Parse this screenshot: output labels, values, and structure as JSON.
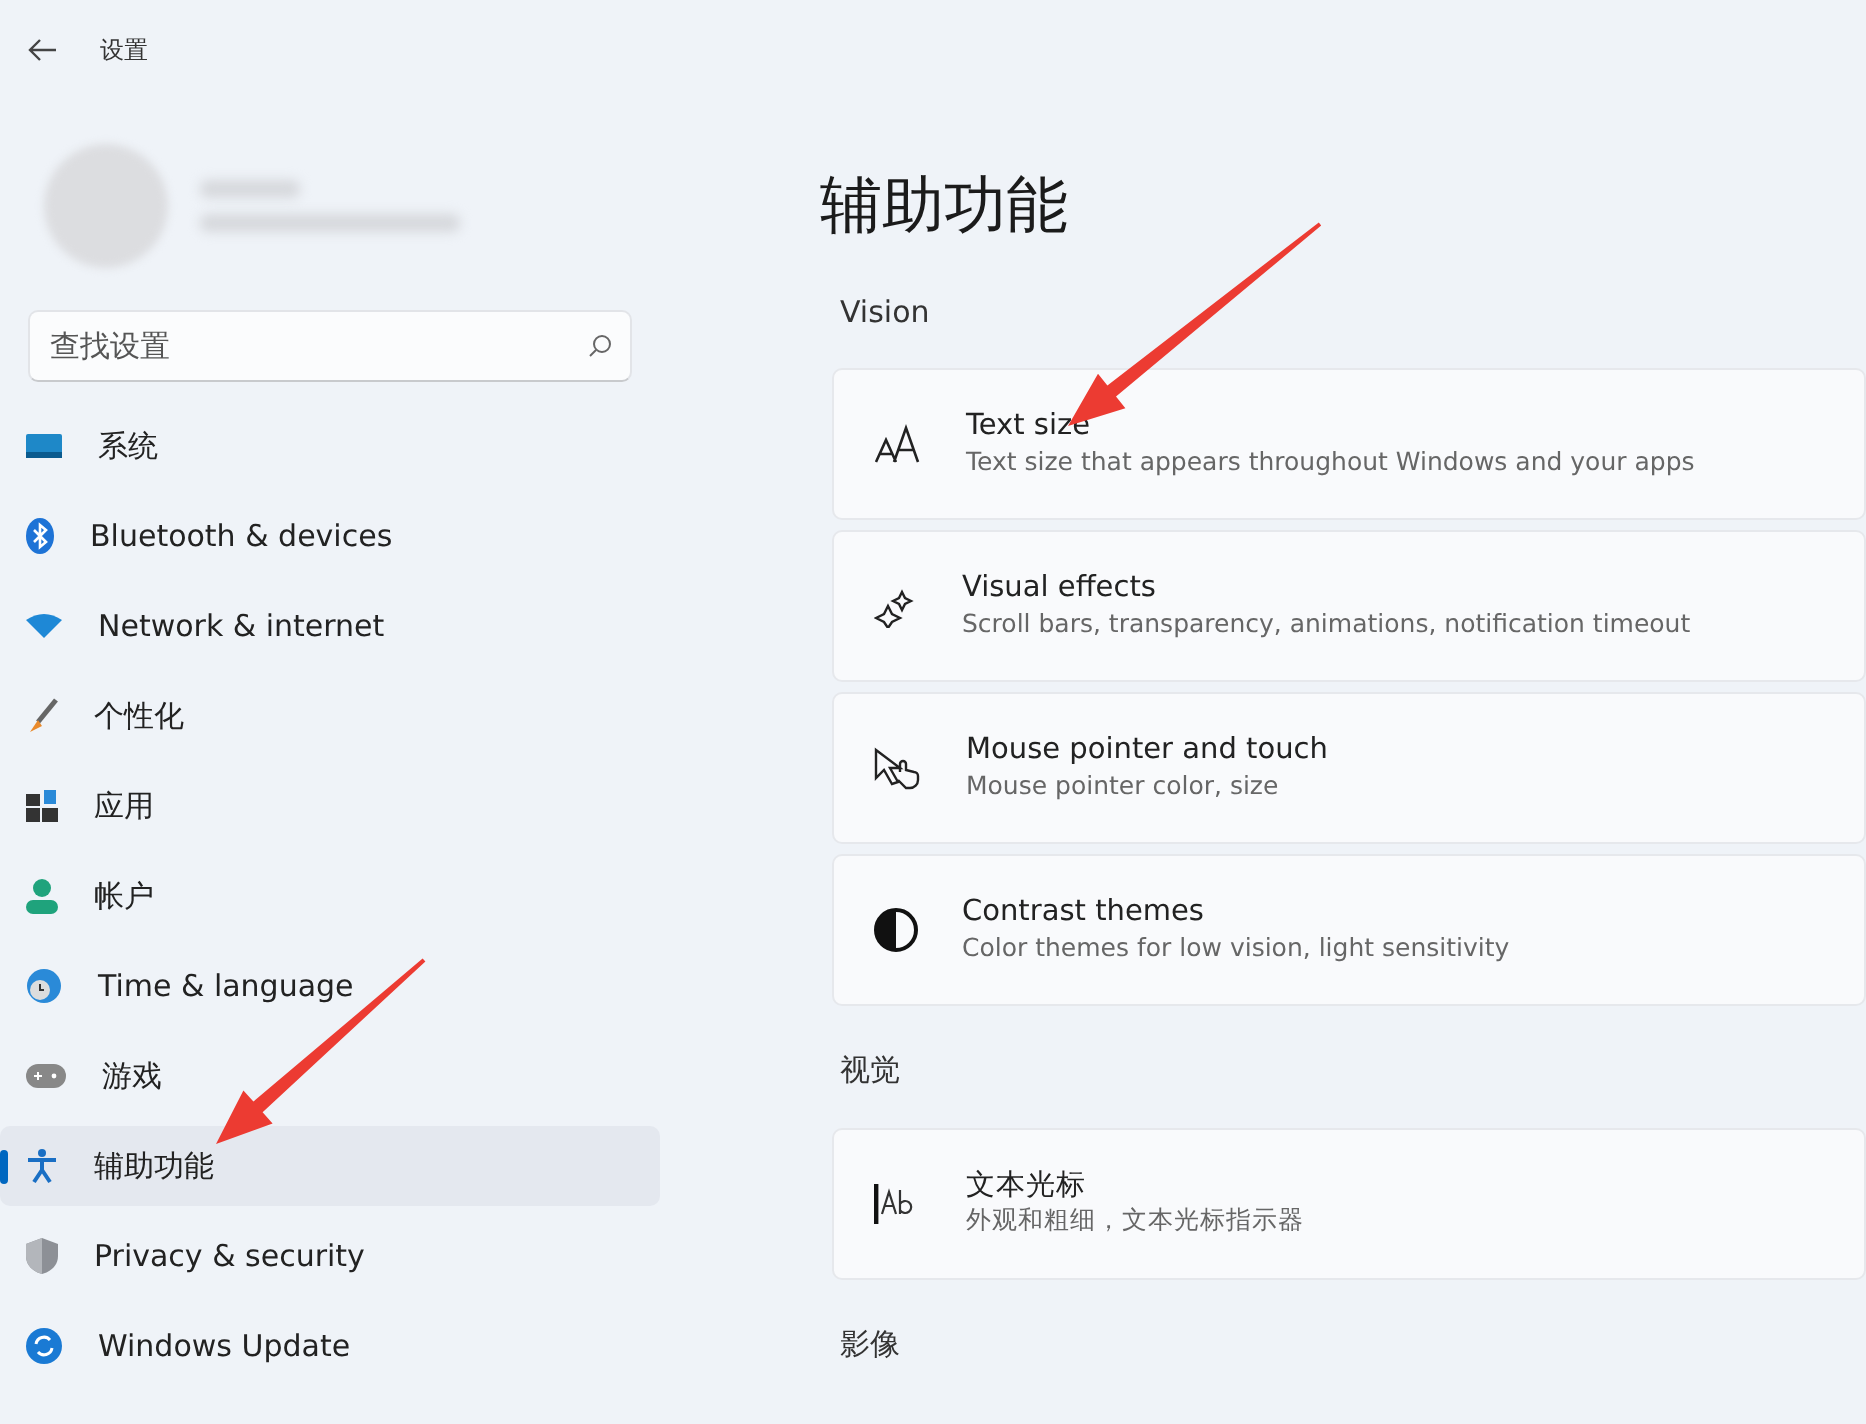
{
  "window": {
    "title": "设置"
  },
  "search": {
    "placeholder": "查找设置"
  },
  "sidebar": {
    "items": [
      {
        "label": "系统",
        "selected": false
      },
      {
        "label": "Bluetooth & devices",
        "selected": false
      },
      {
        "label": "Network & internet",
        "selected": false
      },
      {
        "label": "个性化",
        "selected": false
      },
      {
        "label": "应用",
        "selected": false
      },
      {
        "label": "帐户",
        "selected": false
      },
      {
        "label": "Time & language",
        "selected": false
      },
      {
        "label": "游戏",
        "selected": false
      },
      {
        "label": "辅助功能",
        "selected": true
      },
      {
        "label": "Privacy & security",
        "selected": false
      },
      {
        "label": "Windows Update",
        "selected": false
      }
    ]
  },
  "page": {
    "title": "辅助功能",
    "sections": [
      {
        "title": "Vision",
        "items": [
          {
            "title": "Text size",
            "description": "Text size that appears throughout Windows and your apps"
          },
          {
            "title": "Visual effects",
            "description": "Scroll bars, transparency, animations, notification timeout"
          },
          {
            "title": "Mouse pointer and touch",
            "description": "Mouse pointer color, size"
          },
          {
            "title": "Contrast themes",
            "description": "Color themes for low vision, light sensitivity"
          }
        ]
      },
      {
        "title": "视觉",
        "items": [
          {
            "title": "文本光标",
            "description": "外观和粗细，文本光标指示器"
          }
        ]
      },
      {
        "title": "影像"
      }
    ]
  }
}
